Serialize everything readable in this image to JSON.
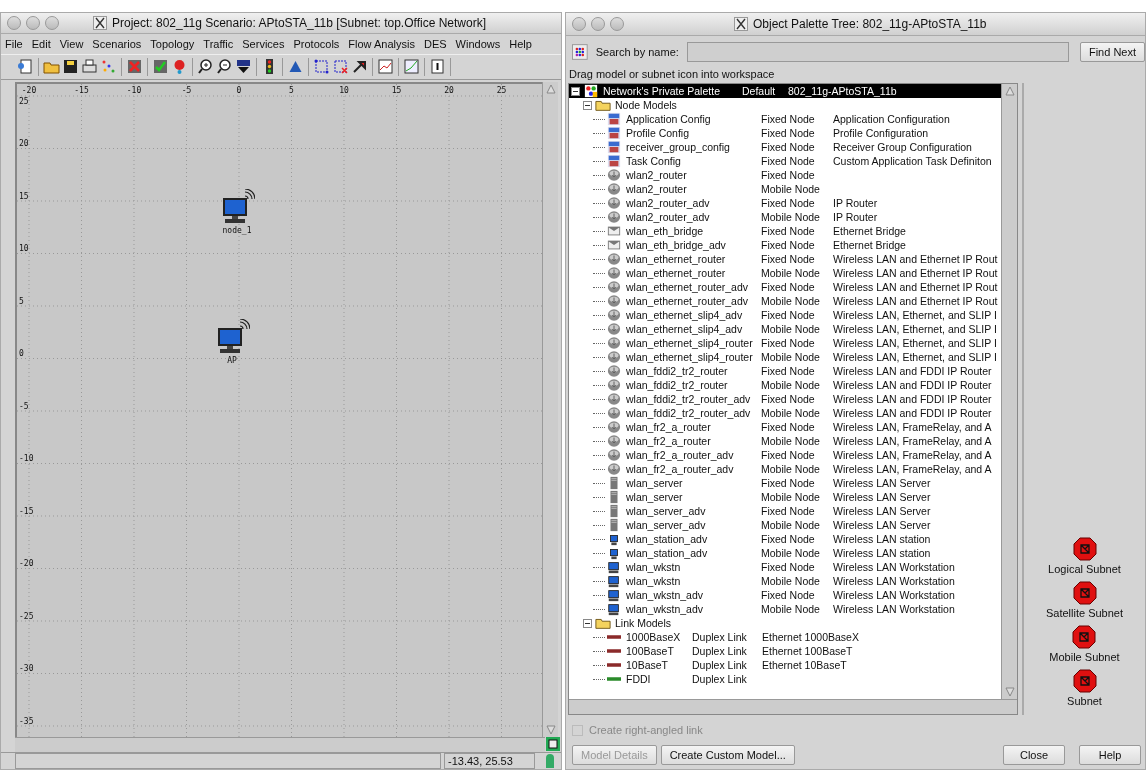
{
  "left_window": {
    "title": "Project: 802_11g Scenario: APtoSTA_11b  [Subnet: top.Office Network]",
    "menu": [
      "File",
      "Edit",
      "View",
      "Scenarios",
      "Topology",
      "Traffic",
      "Services",
      "Protocols",
      "Flow Analysis",
      "DES",
      "Windows",
      "Help"
    ],
    "workspace": {
      "x_ticks": [
        "-20",
        "-15",
        "-10",
        "-5",
        "0",
        "5",
        "10",
        "15",
        "20",
        "25"
      ],
      "y_ticks": [
        "25",
        "20",
        "15",
        "10",
        "5",
        "0",
        "-5",
        "-10",
        "-15",
        "-20",
        "-25",
        "-30",
        "-35"
      ],
      "nodes": [
        {
          "label": "node_1"
        },
        {
          "label": "AP"
        }
      ]
    },
    "status_bar": {
      "coordinates": "-13.43, 25.53"
    }
  },
  "right_window": {
    "title": "Object Palette Tree: 802_11g-APtoSTA_11b",
    "search": {
      "label": "Search by name:",
      "button": "Find Next"
    },
    "hint": "Drag model or subnet icon into workspace",
    "tree": {
      "root": {
        "name": "Network's Private Palette",
        "type": "Default",
        "description": "802_11g-APtoSTA_11b",
        "selected": true,
        "expanded": true
      },
      "groups": [
        {
          "name": "Node Models",
          "expanded": true,
          "children": [
            {
              "kind": "config",
              "name": "Application Config",
              "type": "Fixed Node",
              "description": "Application Configuration"
            },
            {
              "kind": "config",
              "name": "Profile Config",
              "type": "Fixed Node",
              "description": "Profile Configuration"
            },
            {
              "kind": "config",
              "name": "receiver_group_config",
              "type": "Fixed Node",
              "description": "Receiver Group Configuration"
            },
            {
              "kind": "config",
              "name": "Task Config",
              "type": "Fixed Node",
              "description": "Custom Application Task Definiton"
            },
            {
              "kind": "router",
              "name": "wlan2_router",
              "type": "Fixed Node"
            },
            {
              "kind": "router",
              "name": "wlan2_router",
              "type": "Mobile Node"
            },
            {
              "kind": "router",
              "name": "wlan2_router_adv",
              "type": "Fixed Node",
              "description": "IP Router"
            },
            {
              "kind": "router",
              "name": "wlan2_router_adv",
              "type": "Mobile Node",
              "description": "IP Router"
            },
            {
              "kind": "bridge",
              "name": "wlan_eth_bridge",
              "type": "Fixed Node",
              "description": "Ethernet Bridge"
            },
            {
              "kind": "bridge",
              "name": "wlan_eth_bridge_adv",
              "type": "Fixed Node",
              "description": "Ethernet Bridge"
            },
            {
              "kind": "router",
              "name": "wlan_ethernet_router",
              "type": "Fixed Node",
              "description": "Wireless LAN and Ethernet IP Rout"
            },
            {
              "kind": "router",
              "name": "wlan_ethernet_router",
              "type": "Mobile Node",
              "description": "Wireless LAN and Ethernet IP Rout"
            },
            {
              "kind": "router",
              "name": "wlan_ethernet_router_adv",
              "type": "Fixed Node",
              "description": "Wireless LAN and Ethernet IP Rout"
            },
            {
              "kind": "router",
              "name": "wlan_ethernet_router_adv",
              "type": "Mobile Node",
              "description": "Wireless LAN and Ethernet IP Rout"
            },
            {
              "kind": "router",
              "name": "wlan_ethernet_slip4_adv",
              "type": "Fixed Node",
              "description": "Wireless LAN, Ethernet, and SLIP I"
            },
            {
              "kind": "router",
              "name": "wlan_ethernet_slip4_adv",
              "type": "Mobile Node",
              "description": "Wireless LAN, Ethernet, and SLIP I"
            },
            {
              "kind": "router",
              "name": "wlan_ethernet_slip4_router",
              "type": "Fixed Node",
              "description": "Wireless LAN, Ethernet, and SLIP I"
            },
            {
              "kind": "router",
              "name": "wlan_ethernet_slip4_router",
              "type": "Mobile Node",
              "description": "Wireless LAN, Ethernet, and SLIP I"
            },
            {
              "kind": "router",
              "name": "wlan_fddi2_tr2_router",
              "type": "Fixed Node",
              "description": "Wireless LAN and FDDI IP Router"
            },
            {
              "kind": "router",
              "name": "wlan_fddi2_tr2_router",
              "type": "Mobile Node",
              "description": "Wireless LAN and FDDI IP Router"
            },
            {
              "kind": "router",
              "name": "wlan_fddi2_tr2_router_adv",
              "type": "Fixed Node",
              "description": "Wireless LAN and FDDI IP Router"
            },
            {
              "kind": "router",
              "name": "wlan_fddi2_tr2_router_adv",
              "type": "Mobile Node",
              "description": "Wireless LAN and FDDI IP Router"
            },
            {
              "kind": "router",
              "name": "wlan_fr2_a_router",
              "type": "Fixed Node",
              "description": "Wireless LAN, FrameRelay, and A"
            },
            {
              "kind": "router",
              "name": "wlan_fr2_a_router",
              "type": "Mobile Node",
              "description": "Wireless LAN, FrameRelay, and A"
            },
            {
              "kind": "router",
              "name": "wlan_fr2_a_router_adv",
              "type": "Fixed Node",
              "description": "Wireless LAN, FrameRelay, and A"
            },
            {
              "kind": "router",
              "name": "wlan_fr2_a_router_adv",
              "type": "Mobile Node",
              "description": "Wireless LAN, FrameRelay, and A"
            },
            {
              "kind": "server",
              "name": "wlan_server",
              "type": "Fixed Node",
              "description": "Wireless LAN Server"
            },
            {
              "kind": "server",
              "name": "wlan_server",
              "type": "Mobile Node",
              "description": "Wireless LAN Server"
            },
            {
              "kind": "server",
              "name": "wlan_server_adv",
              "type": "Fixed Node",
              "description": "Wireless LAN Server"
            },
            {
              "kind": "server",
              "name": "wlan_server_adv",
              "type": "Mobile Node",
              "description": "Wireless LAN Server"
            },
            {
              "kind": "station",
              "name": "wlan_station_adv",
              "type": "Fixed Node",
              "description": "Wireless LAN station"
            },
            {
              "kind": "station",
              "name": "wlan_station_adv",
              "type": "Mobile Node",
              "description": "Wireless LAN station"
            },
            {
              "kind": "workstation",
              "name": "wlan_wkstn",
              "type": "Fixed Node",
              "description": "Wireless LAN Workstation"
            },
            {
              "kind": "workstation",
              "name": "wlan_wkstn",
              "type": "Mobile Node",
              "description": "Wireless LAN Workstation"
            },
            {
              "kind": "workstation",
              "name": "wlan_wkstn_adv",
              "type": "Fixed Node",
              "description": "Wireless LAN Workstation"
            },
            {
              "kind": "workstation",
              "name": "wlan_wkstn_adv",
              "type": "Mobile Node",
              "description": "Wireless LAN Workstation"
            }
          ]
        },
        {
          "name": "Link Models",
          "expanded": true,
          "children": [
            {
              "kind": "link",
              "color": "#8b2a2a",
              "name": "1000BaseX",
              "type": "Duplex Link",
              "description": "Ethernet 1000BaseX"
            },
            {
              "kind": "link",
              "color": "#8b2a2a",
              "name": "100BaseT",
              "type": "Duplex Link",
              "description": "Ethernet 100BaseT"
            },
            {
              "kind": "link",
              "color": "#8b2a2a",
              "name": "10BaseT",
              "type": "Duplex Link",
              "description": "Ethernet 10BaseT"
            },
            {
              "kind": "link",
              "color": "#2a8b2a",
              "name": "FDDI",
              "type": "Duplex Link"
            }
          ]
        }
      ]
    },
    "subnets": [
      "Logical Subnet",
      "Satellite Subnet",
      "Mobile Subnet",
      "Subnet"
    ],
    "right_angled_link": {
      "label": "Create right-angled link",
      "checked": false,
      "disabled": true
    },
    "buttons": [
      {
        "label": "Model Details",
        "disabled": true
      },
      {
        "label": "Create Custom Model...",
        "disabled": false
      },
      {
        "label": "Close",
        "disabled": false
      },
      {
        "label": "Help",
        "disabled": false
      }
    ]
  }
}
